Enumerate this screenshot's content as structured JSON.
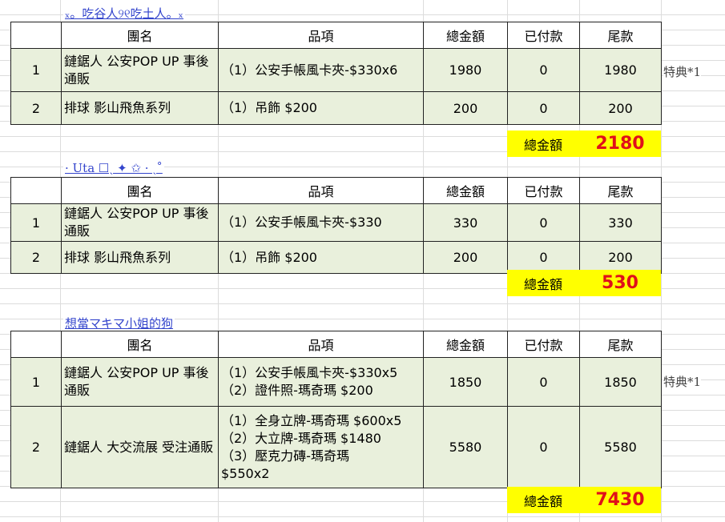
{
  "headers": {
    "group": "團名",
    "item": "品項",
    "total": "總金額",
    "paid": "已付款",
    "balance": "尾款"
  },
  "sum_label": "總金額",
  "bonus_note": "特典*1",
  "orders": [
    {
      "buyer": "ₓ。吃谷人୨୧吃土人。ₓ",
      "rows": [
        {
          "no": "1",
          "group": "鏈鋸人 公安POP UP 事後通販",
          "items": [
            "（1）公安手帳風卡夾-$330x6"
          ],
          "total": "1980",
          "paid": "0",
          "balance": "1980"
        },
        {
          "no": "2",
          "group": "排球 影山飛魚系列",
          "items": [
            "（1）吊飾  $200"
          ],
          "total": "200",
          "paid": "0",
          "balance": "200"
        }
      ],
      "sum": "2180"
    },
    {
      "buyer": "· Uta ☐ˎ ✦ ✩ · ˎ˚",
      "rows": [
        {
          "no": "1",
          "group": "鏈鋸人 公安POP UP 事後通販",
          "items": [
            "（1）公安手帳風卡夾-$330"
          ],
          "total": "330",
          "paid": "0",
          "balance": "330"
        },
        {
          "no": "2",
          "group": "排球 影山飛魚系列",
          "items": [
            "（1）吊飾  $200"
          ],
          "total": "200",
          "paid": "0",
          "balance": "200"
        }
      ],
      "sum": "530"
    },
    {
      "buyer": "想當マキマ小姐的狗",
      "rows": [
        {
          "no": "1",
          "group": "鏈鋸人 公安POP UP 事後通販",
          "items": [
            "（1）公安手帳風卡夾-$330x5",
            "（2）證件照-瑪奇瑪 $200"
          ],
          "total": "1850",
          "paid": "0",
          "balance": "1850"
        },
        {
          "no": "2",
          "group": "鏈鋸人 大交流展 受注通販",
          "items": [
            "（1）全身立牌-瑪奇瑪 $600x5",
            "（2）大立牌-瑪奇瑪  $1480",
            "（3）壓克力磚-瑪奇瑪",
            "$550x2"
          ],
          "total": "5580",
          "paid": "0",
          "balance": "5580"
        }
      ],
      "sum": "7430"
    }
  ]
}
